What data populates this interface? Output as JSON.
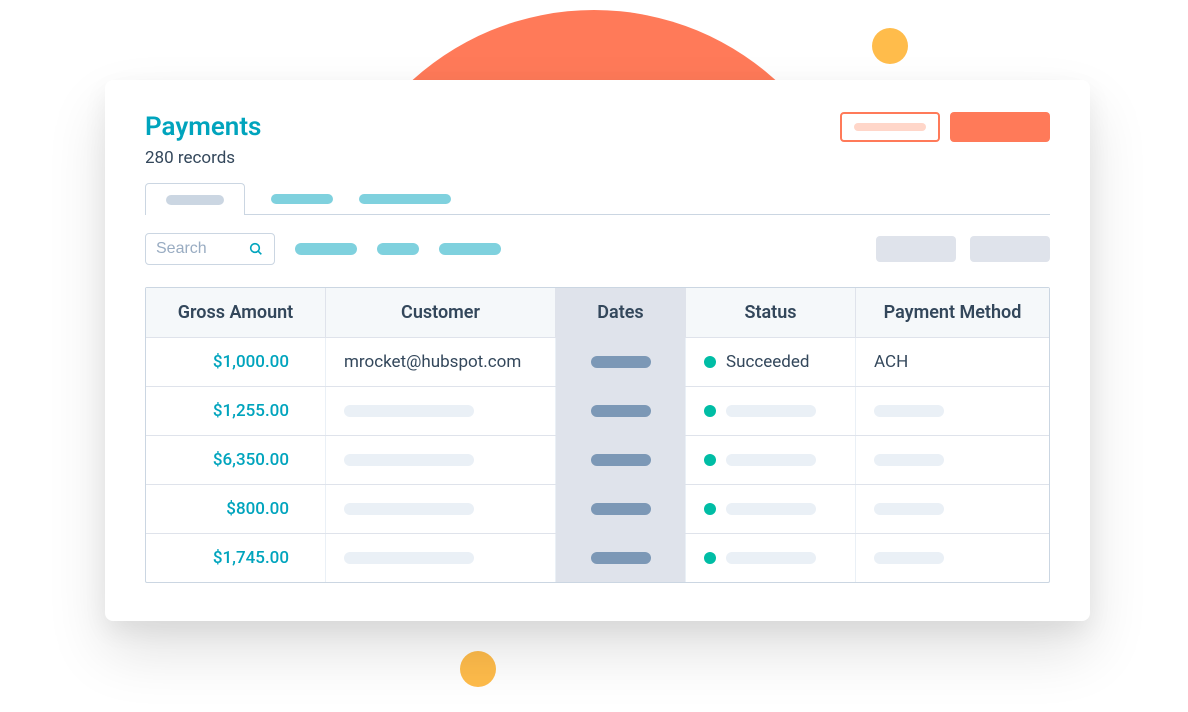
{
  "header": {
    "title": "Payments",
    "record_count": "280 records"
  },
  "search": {
    "placeholder": "Search"
  },
  "columns": {
    "gross_amount": "Gross Amount",
    "customer": "Customer",
    "dates": "Dates",
    "status": "Status",
    "payment_method": "Payment Method"
  },
  "statuses": {
    "succeeded": "Succeeded"
  },
  "rows": [
    {
      "amount": "$1,000.00",
      "customer": "mrocket@hubspot.com",
      "status": "Succeeded",
      "method": "ACH"
    },
    {
      "amount": "$1,255.00",
      "customer": "",
      "status": "",
      "method": ""
    },
    {
      "amount": "$6,350.00",
      "customer": "",
      "status": "",
      "method": ""
    },
    {
      "amount": "$800.00",
      "customer": "",
      "status": "",
      "method": ""
    },
    {
      "amount": "$1,745.00",
      "customer": "",
      "status": "",
      "method": ""
    }
  ],
  "colors": {
    "accent": "#00a4bd",
    "brand": "#ff7a59",
    "success": "#00bda5"
  }
}
